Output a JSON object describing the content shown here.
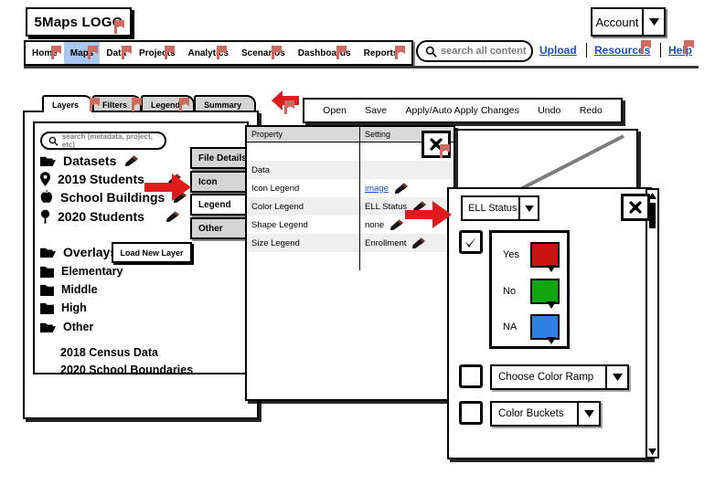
{
  "header": {
    "logo": "5Maps LOGO",
    "account_label": "Account",
    "nav_items": [
      {
        "label": "Home",
        "active": false
      },
      {
        "label": "Maps",
        "active": true
      },
      {
        "label": "Data",
        "active": false
      },
      {
        "label": "Projects",
        "active": false
      },
      {
        "label": "Analytics",
        "active": false
      },
      {
        "label": "Scenarios",
        "active": false
      },
      {
        "label": "Dashboards",
        "active": false
      },
      {
        "label": "Reports",
        "active": false
      }
    ],
    "search_placeholder": "search all content",
    "links": [
      "Upload",
      "Resources",
      "Help"
    ]
  },
  "panel_tabs": [
    {
      "label": "Layers",
      "active": true
    },
    {
      "label": "Filters",
      "active": false
    },
    {
      "label": "Legend",
      "active": false
    },
    {
      "label": "Summary",
      "active": false
    }
  ],
  "layers_panel": {
    "search_placeholder": "search (metadata, project, etc)",
    "load_button": "Load New Layer",
    "items": [
      {
        "label": "Datasets",
        "icon": "open-folder-icon",
        "editable": true,
        "indent": 0
      },
      {
        "label": "2019 Students",
        "icon": "map-pin-icon",
        "editable": true,
        "indent": 1
      },
      {
        "label": "School Buildings",
        "icon": "apple-icon",
        "editable": true,
        "indent": 1
      },
      {
        "label": "2020 Students",
        "icon": "lollipop-pin-icon",
        "editable": true,
        "indent": 1
      },
      {
        "label": "Overlays",
        "icon": "open-folder-icon",
        "editable": false,
        "indent": 0
      },
      {
        "label": "Elementary",
        "icon": "closed-folder-icon",
        "editable": false,
        "indent": 1
      },
      {
        "label": "Middle",
        "icon": "closed-folder-icon",
        "editable": false,
        "indent": 1
      },
      {
        "label": "High",
        "icon": "closed-folder-icon",
        "editable": false,
        "indent": 1
      },
      {
        "label": "Other",
        "icon": "open-folder-icon",
        "editable": false,
        "indent": 1
      },
      {
        "label": "2018 Census Data",
        "icon": "none",
        "editable": false,
        "indent": 2
      },
      {
        "label": "2020 School Boundaries",
        "icon": "none",
        "editable": false,
        "indent": 2
      }
    ]
  },
  "side_buttons": [
    {
      "label": "File Details",
      "active": false
    },
    {
      "label": "Icon",
      "active": false
    },
    {
      "label": "Legend",
      "active": true
    },
    {
      "label": "Other",
      "active": false
    }
  ],
  "toolbar": {
    "items": [
      "Open",
      "Save",
      "Apply/Auto Apply Changes",
      "Undo",
      "Redo"
    ]
  },
  "property_table": {
    "columns": [
      "Property",
      "Setting"
    ],
    "rows": [
      {
        "property": "",
        "setting": "",
        "link": false,
        "edit": false
      },
      {
        "property": "Data",
        "setting": "",
        "link": false,
        "edit": false
      },
      {
        "property": "Icon Legend",
        "setting": "image",
        "link": true,
        "edit": true
      },
      {
        "property": "Color Legend",
        "setting": "ELL Status",
        "link": false,
        "edit": true
      },
      {
        "property": "Shape Legend",
        "setting": "none",
        "link": false,
        "edit": true
      },
      {
        "property": "Size Legend",
        "setting": "Enrollment",
        "link": false,
        "edit": true
      },
      {
        "property": "",
        "setting": "",
        "link": false,
        "edit": false
      }
    ],
    "close_label": "✖"
  },
  "legend_dialog": {
    "field_select": "ELL Status",
    "enable_checked": true,
    "close_label": "✖",
    "categories": [
      {
        "label": "Yes",
        "color": "#cc1111"
      },
      {
        "label": "No",
        "color": "#12a512"
      },
      {
        "label": "NA",
        "color": "#2f7fe0"
      }
    ],
    "color_ramp": {
      "label": "Choose Color Ramp",
      "checked": false
    },
    "color_buckets": {
      "label": "Color Buckets",
      "checked": false
    }
  }
}
